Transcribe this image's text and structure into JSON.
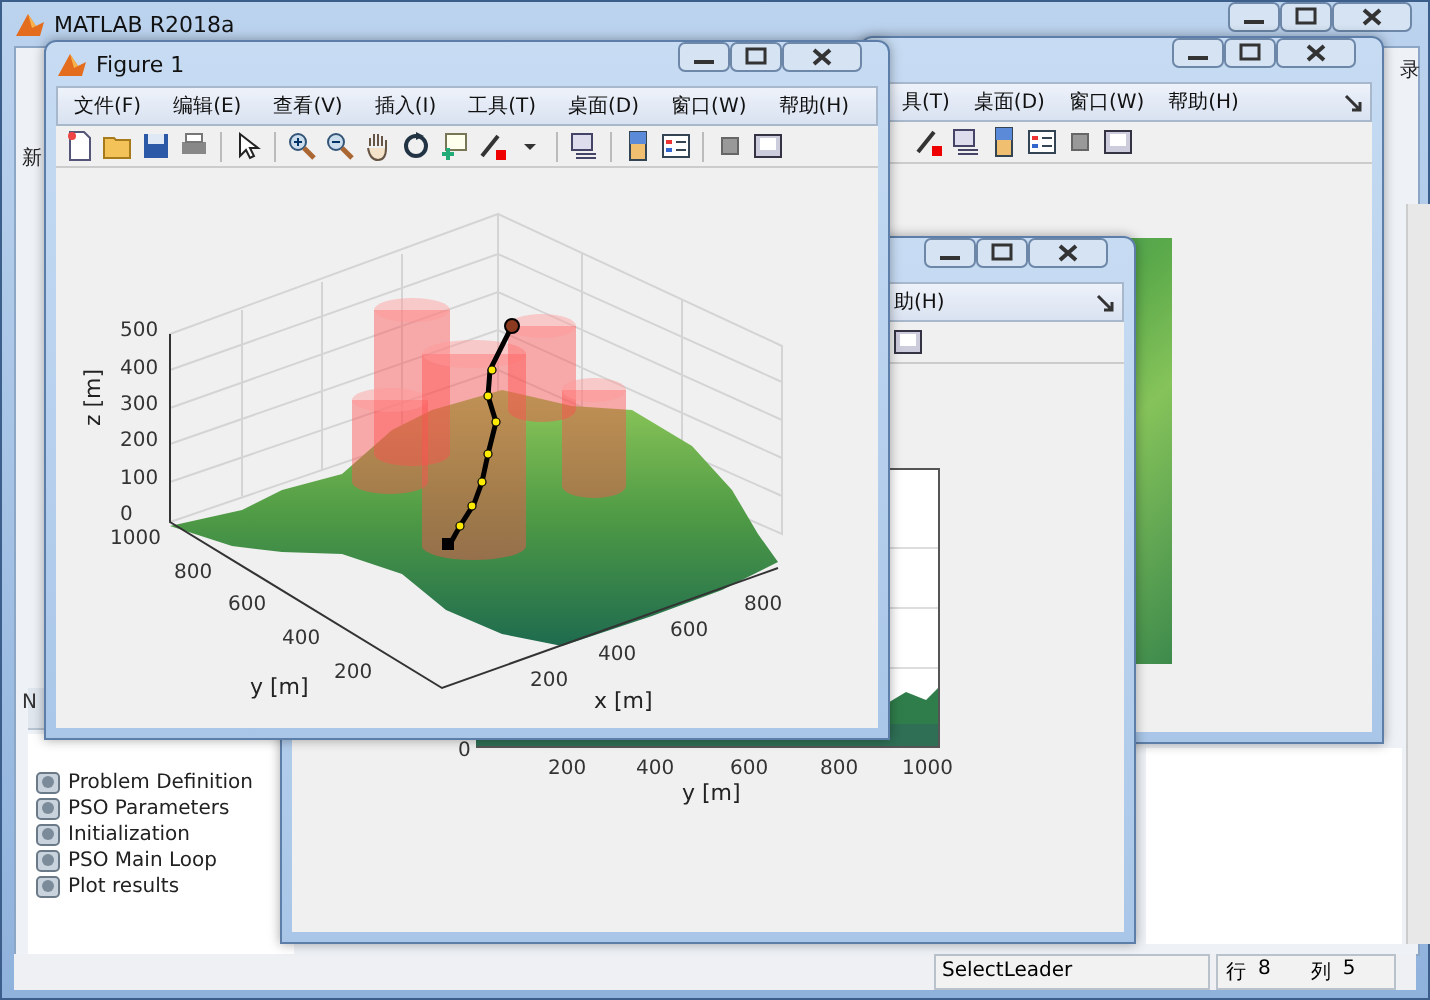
{
  "main_window": {
    "title": "MATLAB R2018a",
    "toolstrip_fragments": [
      "新",
      "录"
    ],
    "panel_header": "N",
    "sections": [
      "Problem Definition",
      "PSO Parameters",
      "Initialization",
      "PSO Main Loop",
      "Plot results"
    ],
    "status_bar": {
      "message": "SelectLeader",
      "row_label": "行",
      "row": "8",
      "col_label": "列",
      "col": "5"
    }
  },
  "back_figure": {
    "menu": [
      "具(T)",
      "桌面(D)",
      "窗口(W)",
      "帮助(H)"
    ]
  },
  "second_figure": {
    "menu": [
      "助(H)"
    ],
    "axes": {
      "ytick": "0",
      "xticks": [
        "200",
        "400",
        "600",
        "800",
        "1000"
      ],
      "xlabel": "y [m]"
    }
  },
  "figure_1": {
    "title": "Figure 1",
    "menu": [
      "文件(F)",
      "编辑(E)",
      "查看(V)",
      "插入(I)",
      "工具(T)",
      "桌面(D)",
      "窗口(W)",
      "帮助(H)"
    ],
    "axes": {
      "zlabel": "z [m]",
      "zticks": [
        "500",
        "400",
        "300",
        "200",
        "100",
        "0"
      ],
      "yticks": [
        "1000",
        "800",
        "600",
        "400",
        "200"
      ],
      "ylabel": "y [m]",
      "xticks": [
        "200",
        "400",
        "600",
        "800"
      ],
      "xlabel": "x [m]"
    }
  }
}
